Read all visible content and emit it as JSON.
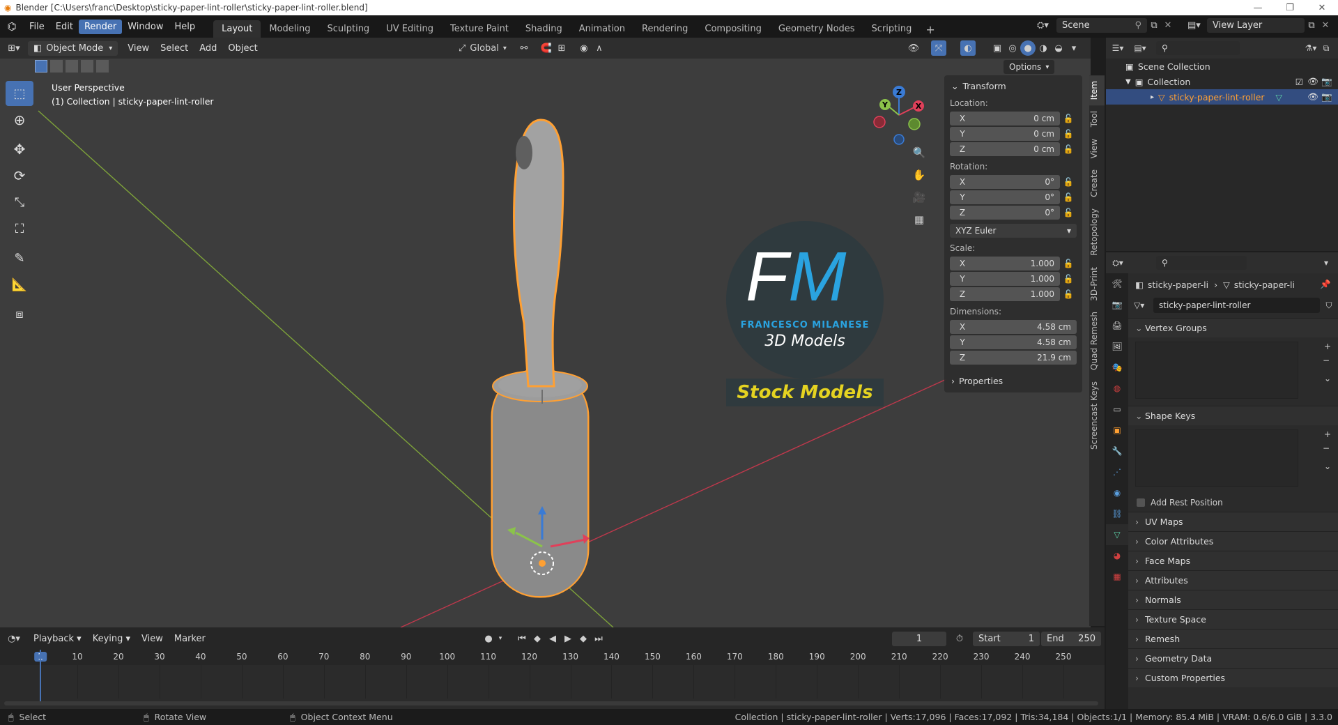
{
  "titlebar": {
    "title": "Blender [C:\\Users\\franc\\Desktop\\sticky-paper-lint-roller\\sticky-paper-lint-roller.blend]",
    "minimize": "—",
    "restore": "❐",
    "close": "✕"
  },
  "menu": {
    "items": [
      "File",
      "Edit",
      "Render",
      "Window",
      "Help"
    ],
    "highlighted": "Render"
  },
  "workspaces": {
    "tabs": [
      "Layout",
      "Modeling",
      "Sculpting",
      "UV Editing",
      "Texture Paint",
      "Shading",
      "Animation",
      "Rendering",
      "Compositing",
      "Geometry Nodes",
      "Scripting"
    ],
    "active": "Layout",
    "add": "+"
  },
  "scene": {
    "scene_name": "Scene",
    "view_layer": "View Layer"
  },
  "viewport_header": {
    "mode": "Object Mode",
    "menus": [
      "View",
      "Select",
      "Add",
      "Object"
    ],
    "orientation": "Global",
    "options": "Options"
  },
  "overlay": {
    "perspective": "User Perspective",
    "collection_info": "(1) Collection | sticky-paper-lint-roller"
  },
  "gizmo": {
    "x": "X",
    "y": "Y",
    "z": "Z"
  },
  "watermark": {
    "initials_f": "F",
    "initials_m": "M",
    "name": "FRANCESCO MILANESE",
    "subtitle": "3D Models",
    "banner": "Stock Models"
  },
  "npanel": {
    "header": "Transform",
    "location_label": "Location:",
    "location": [
      {
        "axis": "X",
        "value": "0 cm"
      },
      {
        "axis": "Y",
        "value": "0 cm"
      },
      {
        "axis": "Z",
        "value": "0 cm"
      }
    ],
    "rotation_label": "Rotation:",
    "rotation": [
      {
        "axis": "X",
        "value": "0°"
      },
      {
        "axis": "Y",
        "value": "0°"
      },
      {
        "axis": "Z",
        "value": "0°"
      }
    ],
    "rotation_mode": "XYZ Euler",
    "scale_label": "Scale:",
    "scale": [
      {
        "axis": "X",
        "value": "1.000"
      },
      {
        "axis": "Y",
        "value": "1.000"
      },
      {
        "axis": "Z",
        "value": "1.000"
      }
    ],
    "dimensions_label": "Dimensions:",
    "dimensions": [
      {
        "axis": "X",
        "value": "4.58 cm"
      },
      {
        "axis": "Y",
        "value": "4.58 cm"
      },
      {
        "axis": "Z",
        "value": "21.9 cm"
      }
    ],
    "properties": "Properties"
  },
  "side_tabs": [
    "Item",
    "Tool",
    "View",
    "Create",
    "Retopology",
    "3D-Print",
    "Quad Remesh",
    "Screencast Keys"
  ],
  "outliner": {
    "scene_collection": "Scene Collection",
    "collection": "Collection",
    "object": "sticky-paper-lint-roller"
  },
  "properties": {
    "breadcrumb_obj": "sticky-paper-li",
    "breadcrumb_data": "sticky-paper-li",
    "mesh_name": "sticky-paper-lint-roller",
    "vertex_groups": "Vertex Groups",
    "shape_keys": "Shape Keys",
    "add_rest_position": "Add Rest Position",
    "sections": [
      "UV Maps",
      "Color Attributes",
      "Face Maps",
      "Attributes",
      "Normals",
      "Texture Space",
      "Remesh",
      "Geometry Data",
      "Custom Properties"
    ]
  },
  "timeline": {
    "menus": [
      "Playback",
      "Keying",
      "View",
      "Marker"
    ],
    "current_frame": "1",
    "start_label": "Start",
    "start": "1",
    "end_label": "End",
    "end": "250",
    "ticks": [
      "1",
      "10",
      "20",
      "30",
      "40",
      "50",
      "60",
      "70",
      "80",
      "90",
      "100",
      "110",
      "120",
      "130",
      "140",
      "150",
      "160",
      "170",
      "180",
      "190",
      "200",
      "210",
      "220",
      "230",
      "240",
      "250"
    ]
  },
  "statusbar": {
    "select": "Select",
    "rotate": "Rotate View",
    "context": "Object Context Menu",
    "info": "Collection | sticky-paper-lint-roller | Verts:17,096 | Faces:17,092 | Tris:34,184 | Objects:1/1 | Memory: 85.4 MiB | VRAM: 0.6/6.0 GiB | 3.3.0"
  },
  "colors": {
    "accent": "#4772b3",
    "selection": "#ffa033",
    "axis_x": "#e0405a",
    "axis_y": "#8bc34a",
    "axis_z": "#3a7bd5",
    "banner_text": "#e5d321",
    "logo_blue": "#2aa3e0"
  }
}
